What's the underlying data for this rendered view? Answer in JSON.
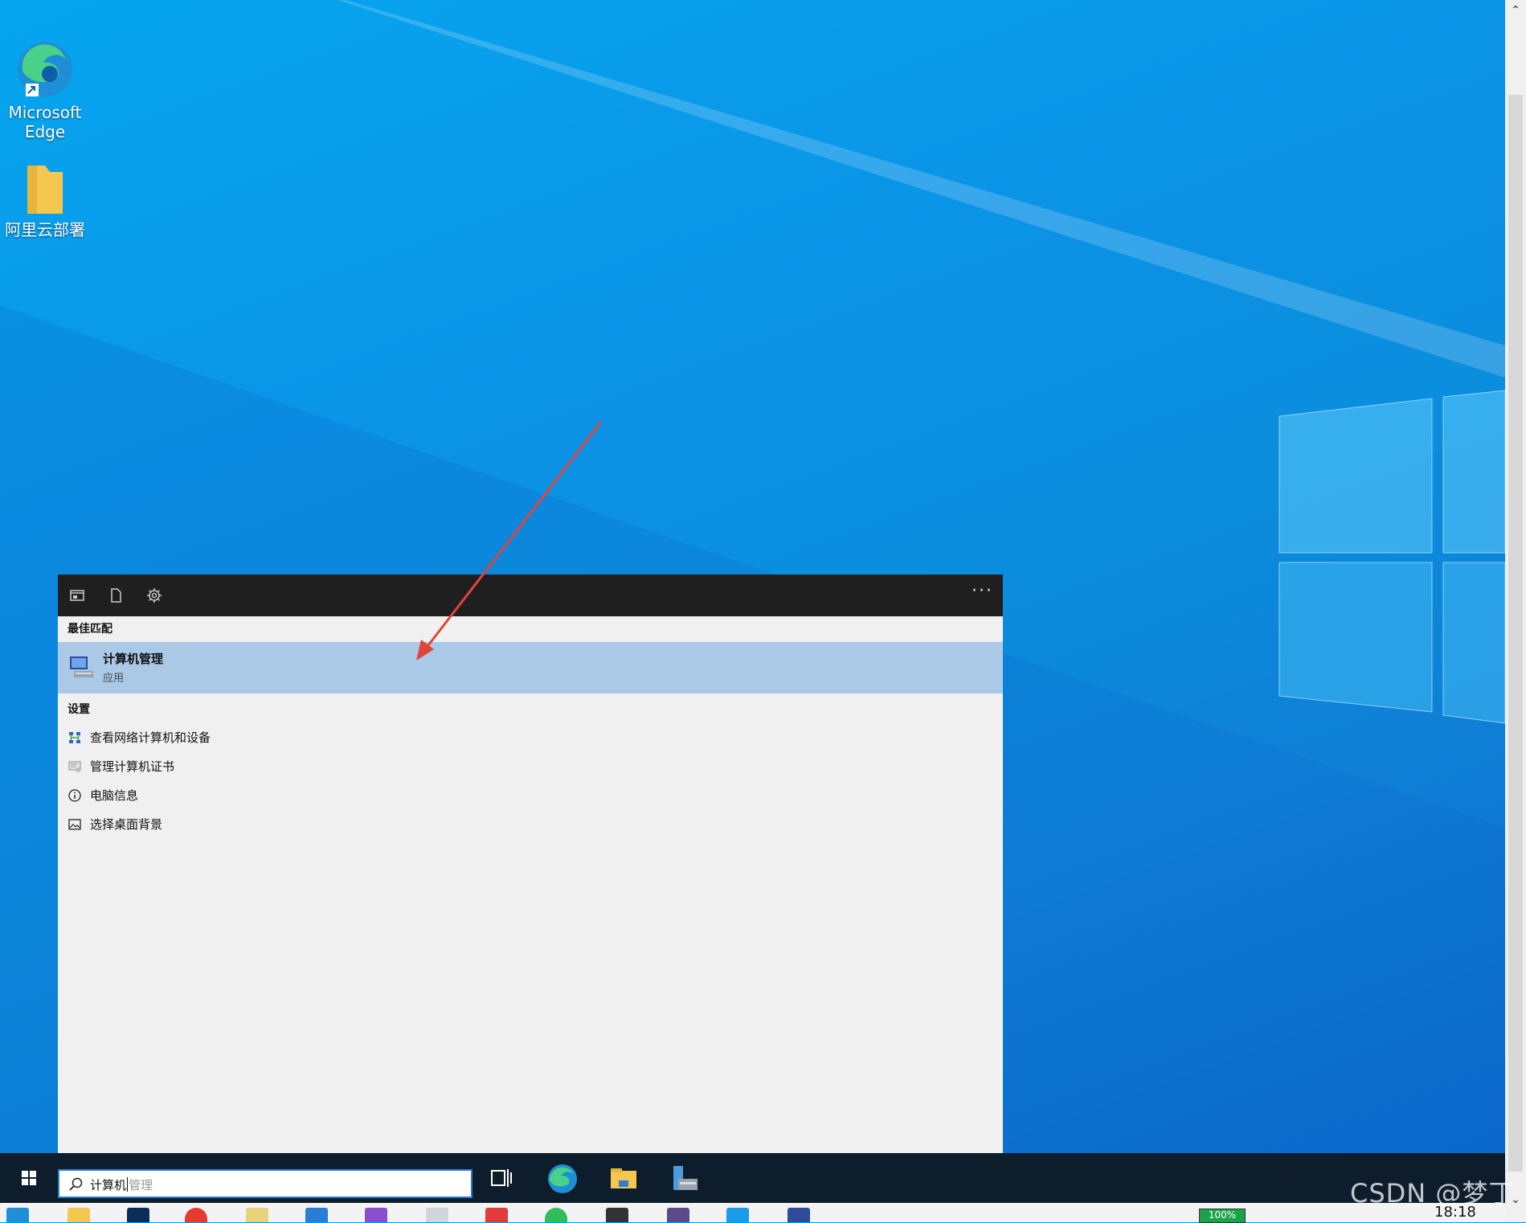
{
  "desktop": {
    "icons": [
      {
        "label_line1": "Microsoft",
        "label_line2": "Edge",
        "icon": "edge-icon"
      },
      {
        "label_line1": "阿里云部署",
        "label_line2": "",
        "icon": "folder-icon"
      }
    ]
  },
  "search_panel": {
    "toolbar": {
      "icons": [
        "apps-filter-icon",
        "documents-filter-icon",
        "settings-filter-icon"
      ],
      "more_label": "···"
    },
    "best_match": {
      "section_title": "最佳匹配",
      "title": "计算机管理",
      "subtitle": "应用",
      "icon": "computer-management-icon"
    },
    "settings": {
      "section_title": "设置",
      "items": [
        {
          "label": "查看网络计算机和设备",
          "icon": "network-icon"
        },
        {
          "label": "管理计算机证书",
          "icon": "certificate-icon"
        },
        {
          "label": "电脑信息",
          "icon": "info-icon"
        },
        {
          "label": "选择桌面背景",
          "icon": "picture-icon"
        }
      ]
    }
  },
  "taskbar": {
    "search": {
      "typed": "计算机",
      "suggestion": "管理"
    },
    "apps": [
      "task-view-icon",
      "edge-icon",
      "file-explorer-icon",
      "computer-management-icon"
    ]
  },
  "tray": {
    "battery": "100%",
    "clock": "18:18"
  },
  "watermark": "CSDN @梦丁",
  "colors": {
    "accent": "#2a7cd4",
    "highlight": "#a9c9e6",
    "taskbar": "#0d1d2c",
    "annotation_arrow": "#e0453a"
  }
}
